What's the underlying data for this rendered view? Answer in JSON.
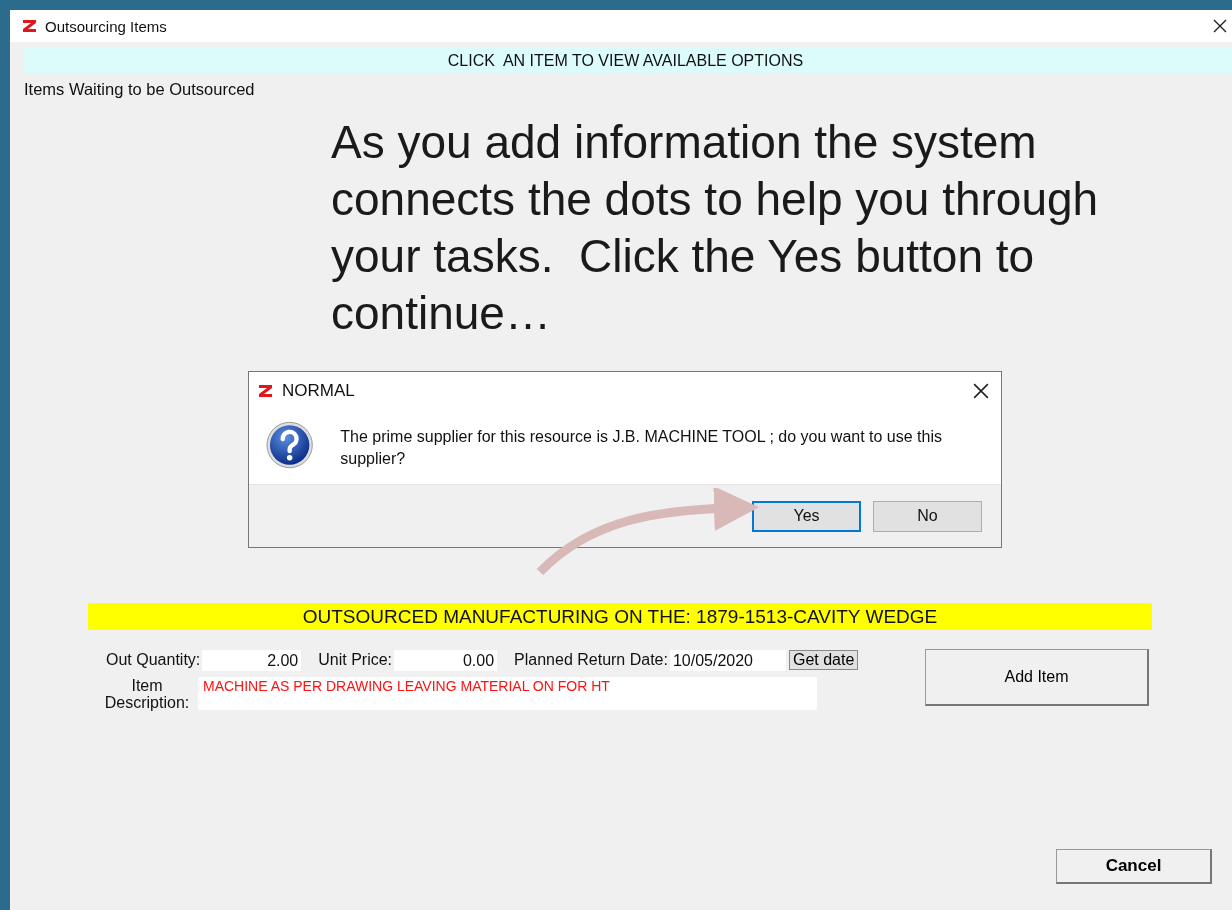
{
  "window": {
    "title": "Outsourcing Items"
  },
  "banner": "CLICK  AN ITEM TO VIEW AVAILABLE OPTIONS",
  "list_label": "Items Waiting to be Outsourced",
  "tutorial_caption": "As you add information the system connects the dots to help you through your tasks.  Click the Yes button to continue…",
  "dialog": {
    "title": "NORMAL",
    "message": "The prime supplier for this resource is J.B. MACHINE TOOL ; do you want to use this supplier?",
    "buttons": [
      {
        "label": "Yes",
        "selected": true
      },
      {
        "label": "No",
        "selected": false
      }
    ]
  },
  "header_bar": "OUTSOURCED MANUFACTURING ON THE: 1879-1513-CAVITY WEDGE",
  "fields": [
    {
      "label": "Out Quantity:",
      "value": "2.00"
    },
    {
      "label": "Unit Price:",
      "value": "0.00"
    },
    {
      "label": "Planned Return Date:",
      "value": "10/05/2020"
    }
  ],
  "get_date_button": "Get date",
  "item_description": {
    "label": "Item Description:",
    "value": "MACHINE AS PER DRAWING LEAVING MATERIAL ON FOR HT"
  },
  "add_item_button": "Add Item",
  "cancel_button": "Cancel"
}
